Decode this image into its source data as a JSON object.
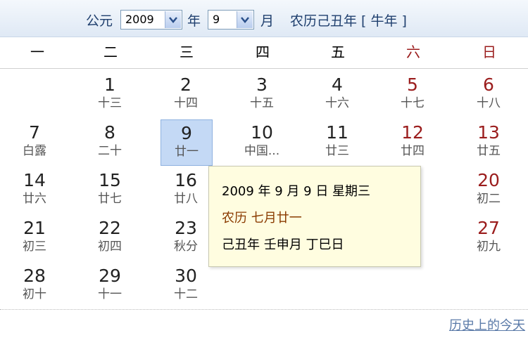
{
  "header": {
    "gregorian_label": "公元",
    "year_value": "2009",
    "year_label": "年",
    "month_value": "9",
    "month_label": "月",
    "lunar_year_text": "农历己丑年 [ 牛年 ]"
  },
  "weekdays": [
    "一",
    "二",
    "三",
    "四",
    "五",
    "六",
    "日"
  ],
  "days": [
    {
      "day": "1",
      "lunar": "十三"
    },
    {
      "day": "2",
      "lunar": "十四"
    },
    {
      "day": "3",
      "lunar": "十五"
    },
    {
      "day": "4",
      "lunar": "十六"
    },
    {
      "day": "5",
      "lunar": "十七"
    },
    {
      "day": "6",
      "lunar": "十八"
    },
    {
      "day": "7",
      "lunar": "白露"
    },
    {
      "day": "8",
      "lunar": "二十"
    },
    {
      "day": "9",
      "lunar": "廿一"
    },
    {
      "day": "10",
      "lunar": "中国..."
    },
    {
      "day": "11",
      "lunar": "廿三"
    },
    {
      "day": "12",
      "lunar": "廿四"
    },
    {
      "day": "13",
      "lunar": "廿五"
    },
    {
      "day": "14",
      "lunar": "廿六"
    },
    {
      "day": "15",
      "lunar": "廿七"
    },
    {
      "day": "16",
      "lunar": "廿八"
    },
    {
      "day": "20",
      "lunar": "初二"
    },
    {
      "day": "21",
      "lunar": "初三"
    },
    {
      "day": "22",
      "lunar": "初四"
    },
    {
      "day": "23",
      "lunar": "秋分"
    },
    {
      "day": "27",
      "lunar": "初九"
    },
    {
      "day": "28",
      "lunar": "初十"
    },
    {
      "day": "29",
      "lunar": "十一"
    },
    {
      "day": "30",
      "lunar": "十二"
    }
  ],
  "tooltip": {
    "date_line": "2009 年 9 月 9 日 星期三",
    "lunar_line": "农历 七月廿一",
    "ganzhi_line": "己丑年 壬申月 丁巳日"
  },
  "footer": {
    "history_link": "历史上的今天"
  },
  "colors": {
    "weekend_red": "#9b1d1d",
    "selected_bg": "#c4d9f5",
    "tooltip_bg": "#fffde0",
    "header_text": "#1f3f6e"
  }
}
